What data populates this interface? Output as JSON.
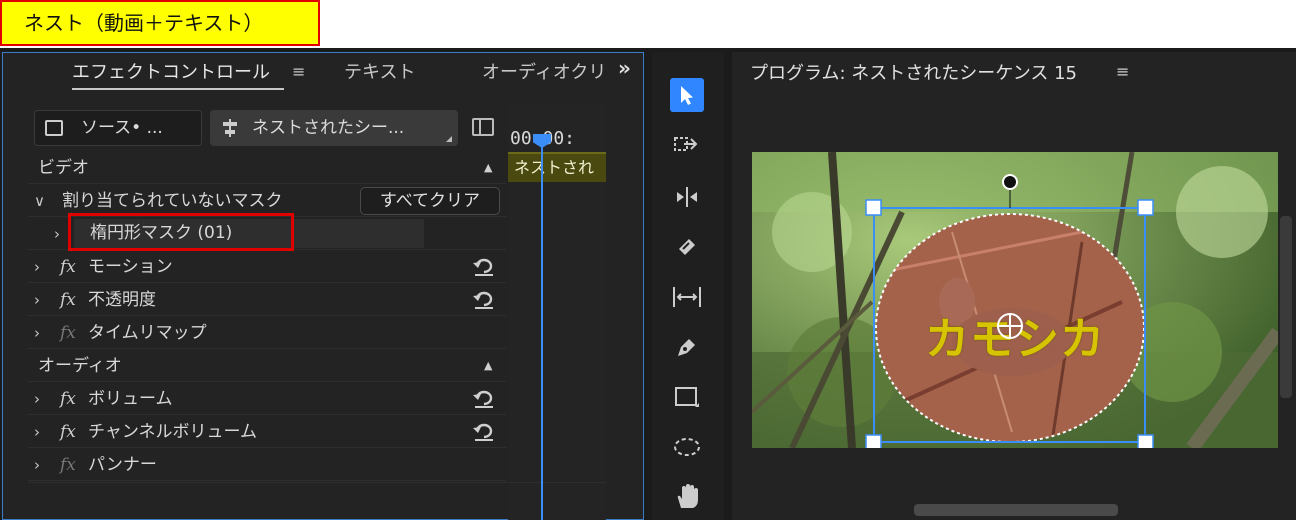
{
  "window_banner": {
    "label": "ネスト（動画＋テキスト）"
  },
  "effect_controls": {
    "tabs": [
      {
        "label": "エフェクトコントロール",
        "active": true
      },
      {
        "label": "テキスト"
      },
      {
        "label": "オーディオクリ"
      }
    ],
    "tab_menu_glyph": "≡",
    "more_tabs_glyph": "»",
    "source_button": "ソース• ...",
    "sequence_button": "ネストされたシー...",
    "sections": {
      "video": "ビデオ",
      "audio": "オーディオ"
    },
    "mask_group": "割り当てられていないマスク",
    "clear_all_button": "すべてクリア",
    "ellipse_mask": "楕円形マスク (01)",
    "fx_glyph": "fx",
    "effects": {
      "motion": "モーション",
      "opacity": "不透明度",
      "time_remap": "タイムリマップ",
      "volume": "ボリューム",
      "channel_volume": "チャンネルボリューム",
      "panner": "パンナー"
    },
    "timeline": {
      "timecode": "00  00:",
      "clip_label": "ネストされ"
    }
  },
  "tools": [
    "selection-tool",
    "track-select-tool",
    "ripple-edit-tool",
    "razor-tool",
    "slip-tool",
    "pen-tool",
    "rectangle-tool",
    "ellipse-tool",
    "hand-tool"
  ],
  "program_monitor": {
    "title": "プログラム: ネストされたシーケンス 15",
    "menu_glyph": "≡",
    "overlay_text": "カモシカ"
  },
  "colors": {
    "accent_blue": "#3a8ef6",
    "highlight_red": "#e00000",
    "banner_yellow": "#ffff00",
    "overlay_text_yellow": "#d6c400"
  }
}
